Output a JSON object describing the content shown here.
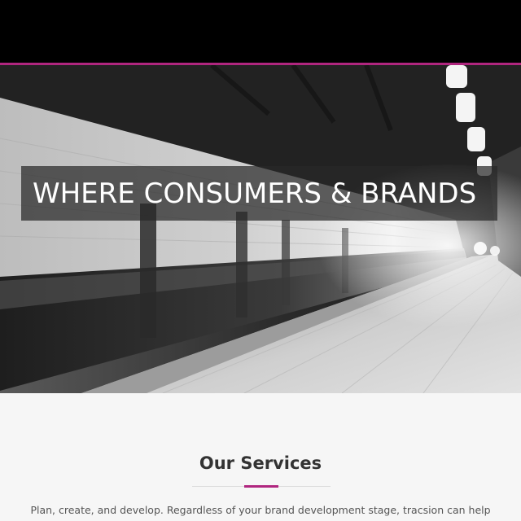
{
  "header": {
    "background_color": "#000000",
    "accent_color": "#b0267f"
  },
  "hero": {
    "title": "WHERE CONSUMERS & BRANDS",
    "image": "subway-platform-photo"
  },
  "services": {
    "title": "Our Services",
    "description": "Plan, create, and develop. Regardless of your brand development stage, tracsion can help"
  }
}
